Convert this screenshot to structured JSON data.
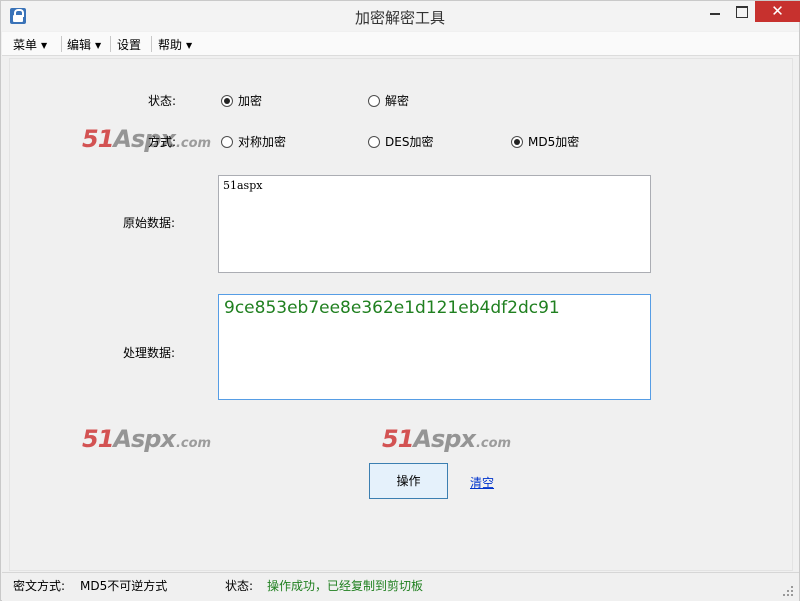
{
  "window": {
    "title": "加密解密工具",
    "close_glyph": "✕"
  },
  "menu": [
    {
      "label": "菜单",
      "has_dropdown": true
    },
    {
      "label": "编辑",
      "has_dropdown": true
    },
    {
      "label": "设置",
      "has_dropdown": false
    },
    {
      "label": "帮助",
      "has_dropdown": true
    }
  ],
  "form": {
    "mode_label": "状态:",
    "mode_options": [
      {
        "label": "加密",
        "checked": true
      },
      {
        "label": "解密",
        "checked": false
      }
    ],
    "method_label": "方式:",
    "method_options": [
      {
        "label": "对称加密",
        "checked": false
      },
      {
        "label": "DES加密",
        "checked": false
      },
      {
        "label": "MD5加密",
        "checked": true
      }
    ],
    "original_label": "原始数据:",
    "original_value": "51aspx",
    "result_label": "处理数据:",
    "result_value": "9ce853eb7ee8e362e1d121eb4df2dc91"
  },
  "actions": {
    "execute_label": "操作",
    "clear_label": "清空"
  },
  "watermark": {
    "part_a": "51",
    "part_b": "Aspx",
    "part_c": ".com"
  },
  "statusbar": {
    "cipher_label": "密文方式:",
    "cipher_value": "MD5不可逆方式",
    "state_label": "状态:",
    "state_value": "操作成功，已经复制到剪切板",
    "state_color": "#208020"
  },
  "colors": {
    "result_text": "#208020",
    "link": "#0033cc",
    "close_button": "#c7312e",
    "accent_border": "#3c7fb1"
  }
}
